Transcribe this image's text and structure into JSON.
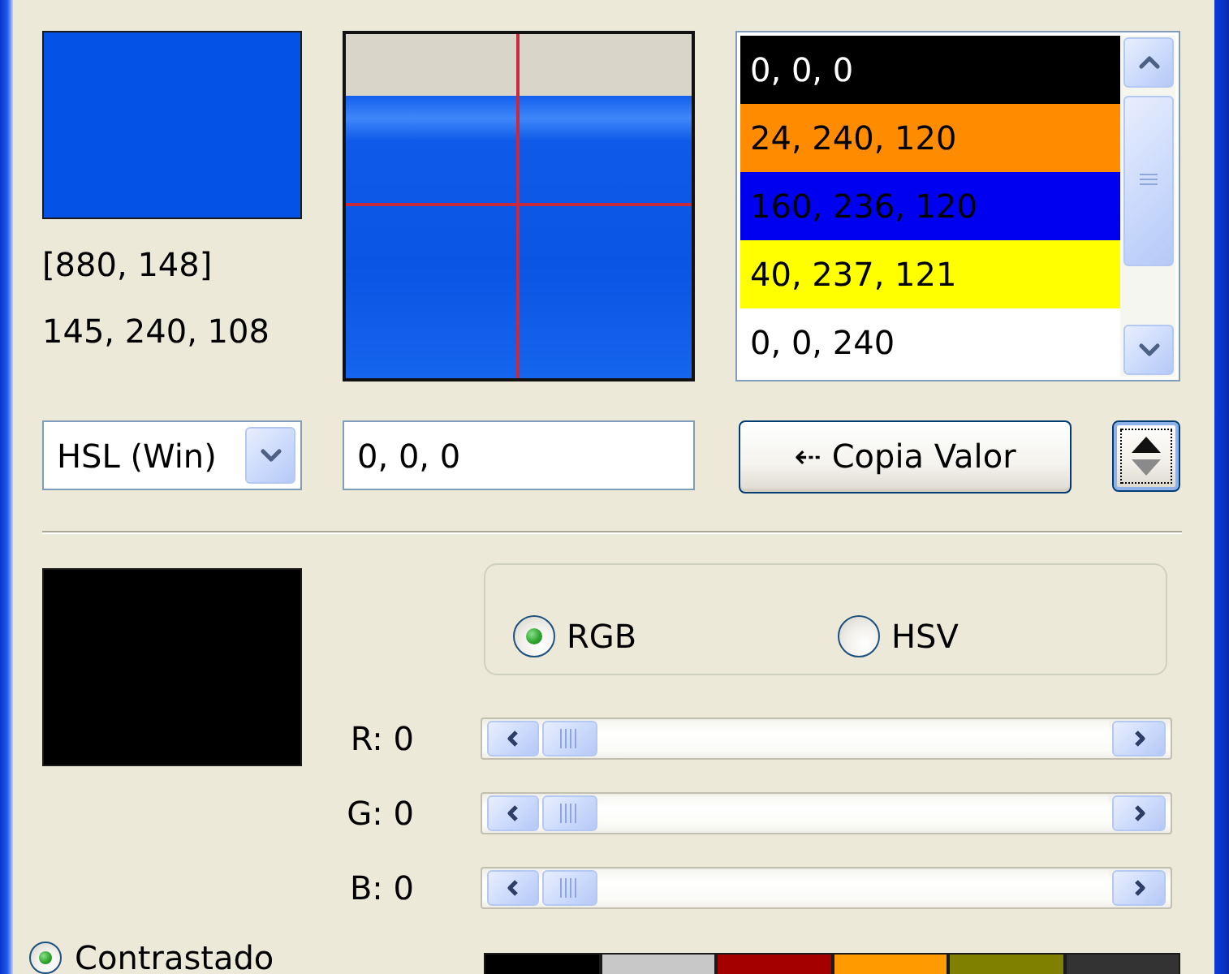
{
  "picked": {
    "color": "#0453e6",
    "position": "[880, 148]",
    "value": "145, 240, 108"
  },
  "color_list": {
    "items": [
      {
        "text": "0, 0, 0",
        "color": "#000000"
      },
      {
        "text": "24, 240, 120",
        "color": "#ff8c00"
      },
      {
        "text": "160, 236, 120",
        "color": "#0000f0"
      },
      {
        "text": "40, 237, 121",
        "color": "#ffff00"
      },
      {
        "text": "0, 0, 240",
        "color": "#ffffff"
      }
    ]
  },
  "format_select": {
    "value": "HSL (Win)"
  },
  "value_field": {
    "value": "0, 0, 0"
  },
  "copy_button": {
    "label": "⇠ Copia Valor"
  },
  "order_button": {
    "focused": true
  },
  "editor": {
    "color": "#000000",
    "color_model": [
      {
        "label": "RGB",
        "selected": true
      },
      {
        "label": "HSV",
        "selected": false
      }
    ],
    "channels": [
      {
        "label": "R: 0",
        "level": 0
      },
      {
        "label": "G: 0",
        "level": 0
      },
      {
        "label": "B: 0",
        "level": 0
      }
    ]
  },
  "contrast_option": {
    "label": "Contrastado",
    "selected": true
  },
  "palette": [
    {
      "color": "#000000"
    },
    {
      "color": "#c8c8c8"
    },
    {
      "color": "#a50000"
    },
    {
      "color": "#ff9a00"
    },
    {
      "color": "#7f8000"
    },
    {
      "color": "#333333"
    }
  ]
}
